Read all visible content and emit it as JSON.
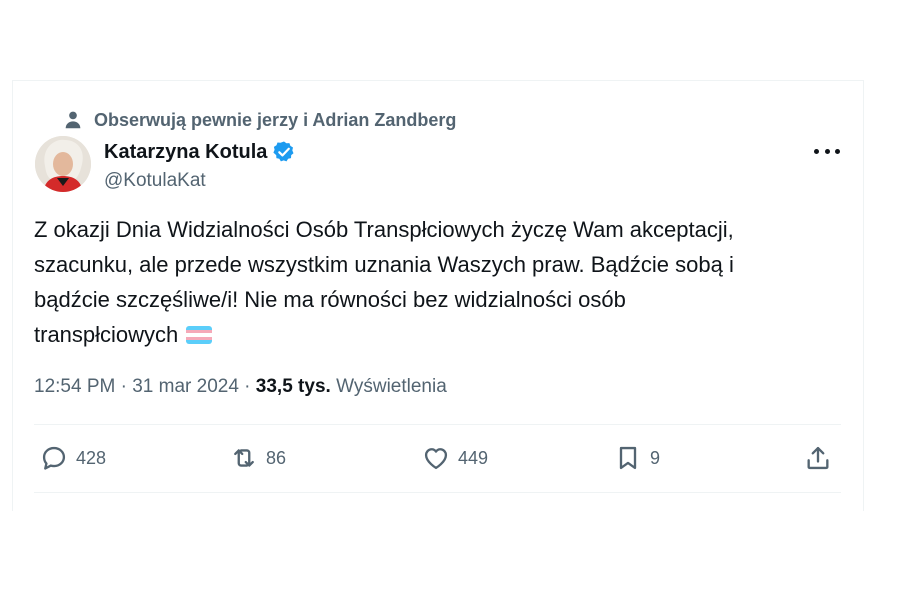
{
  "social_context": {
    "text": "Obserwują pewnie jerzy i Adrian Zandberg",
    "icon": "person-icon"
  },
  "author": {
    "name": "Katarzyna Kotula",
    "handle": "@KotulaKat",
    "verified": true,
    "verified_color": "#1d9bf0"
  },
  "tweet": {
    "lines": [
      "Z okazji Dnia Widzialności Osób Transpłciowych życzę Wam akceptacji,",
      "szacunku, ale przede wszystkim uznania Waszych praw. Bądźcie sobą i",
      "bądźcie szczęśliwe/i! Nie ma równości bez widzialności osób",
      "transpłciowych"
    ],
    "emoji": "transgender-flag-emoji"
  },
  "meta": {
    "time": "12:54 PM",
    "sep1": " · ",
    "date": "31 mar 2024",
    "sep2": " · ",
    "views_count": "33,5 tys.",
    "views_label": "Wyświetlenia"
  },
  "actions": {
    "reply": {
      "icon": "reply-icon",
      "count": "428"
    },
    "retweet": {
      "icon": "retweet-icon",
      "count": "86"
    },
    "like": {
      "icon": "heart-icon",
      "count": "449"
    },
    "bookmark": {
      "icon": "bookmark-icon",
      "count": "9"
    },
    "share": {
      "icon": "share-icon"
    }
  },
  "colors": {
    "text": "#0f1419",
    "secondary": "#536471",
    "divider": "#eff3f4"
  }
}
